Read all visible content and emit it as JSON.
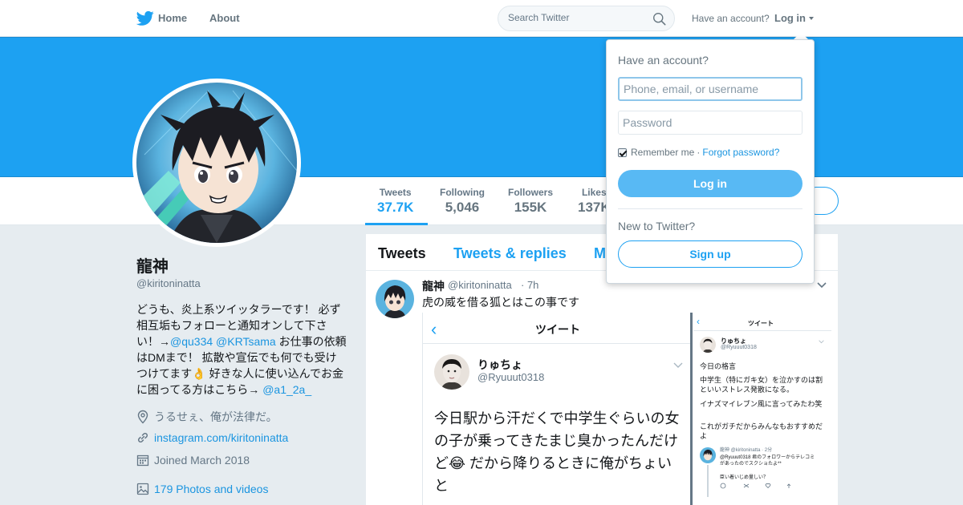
{
  "nav": {
    "logo_icon": "twitter-bird-icon",
    "home_label": "Home",
    "about_label": "About",
    "search_placeholder": "Search Twitter",
    "have_account_text": "Have an account?",
    "login_label": "Log in"
  },
  "colors": {
    "brand": "#1da1f2",
    "link": "#1b95e0",
    "banner": "#1da1f2",
    "page_bg": "#e6ecf0"
  },
  "profile": {
    "name": "龍神",
    "handle": "@kiritoninatta",
    "bio_parts": {
      "p1": "どうも、炎上系ツイッタラーです！ 必ず相互垢もフォローと通知オンして下さい！→",
      "m1": "@qu334",
      "m2": "@KRTsama",
      "p2": " お仕事の依頼はDMまで！ 拡散や宣伝でも何でも受けつけてます",
      "emoji": "👌",
      "p3": " 好きな人に使い込んでお金に困ってる方はこちら→ ",
      "m3": "@a1_2a_"
    },
    "location": "うるせぇ、俺が法律だ。",
    "url": "instagram.com/kiritoninatta",
    "joined": "Joined March 2018",
    "photos": "179 Photos and videos"
  },
  "stats": [
    {
      "label": "Tweets",
      "value": "37.7K"
    },
    {
      "label": "Following",
      "value": "5,046"
    },
    {
      "label": "Followers",
      "value": "155K"
    },
    {
      "label": "Likes",
      "value": "137K"
    }
  ],
  "timeline": {
    "tabs": [
      "Tweets",
      "Tweets & replies",
      "M"
    ],
    "tweet": {
      "name": "龍神",
      "handle": "@kiritoninatta",
      "time": "· 7h",
      "text": "虎の威を借る狐とはこの事です",
      "media_left": {
        "header": "ツイート",
        "name": "りゅちょ",
        "handle": "@Ryuuut0318",
        "body": "今日駅から汗だくで中学生ぐらいの女の子が乗ってきたまじ臭かったんだけど😂 だから降りるときに俺がちょいと"
      },
      "media_right": {
        "header": "ツイート",
        "name": "りゅちょ",
        "handle": "@Ryuuut0318",
        "lines": [
          "今日の格言",
          "中学生（特にガキ女）を泣かすのは割といいストレス発散になる。",
          "イナズマイレブン風に言ってみたわ笑",
          "これがガチだからみんなもおすすめだよ"
        ],
        "reply_meta": "龍神 @kiritoninatta · 2分",
        "reply_text": "@Ryuuut0318 君のフォロワーからテレコミ",
        "reply_text2": "があったのでスクショたよ**",
        "reply_text3": "臣い着いじめ量しい？"
      }
    }
  },
  "login_dropdown": {
    "title": "Have an account?",
    "username_placeholder": "Phone, email, or username",
    "password_placeholder": "Password",
    "remember_label": "Remember me",
    "separator": "·",
    "forgot_label": "Forgot password?",
    "login_button": "Log in",
    "new_text": "New to Twitter?",
    "signup_button": "Sign up"
  }
}
